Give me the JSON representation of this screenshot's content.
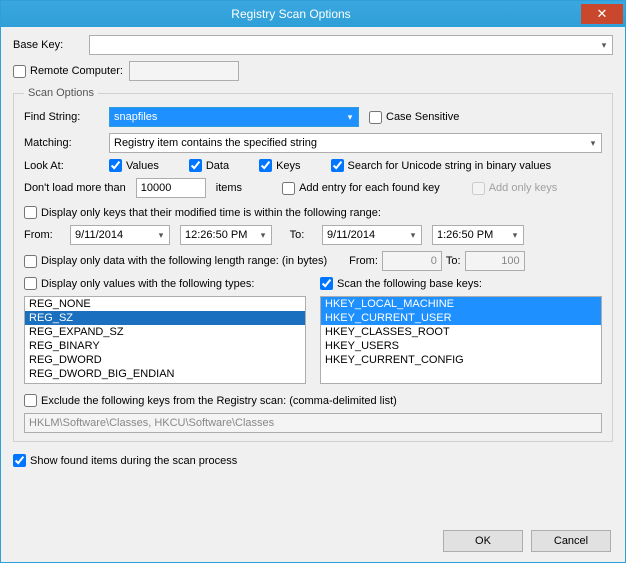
{
  "window": {
    "title": "Registry Scan Options"
  },
  "baseKey": {
    "label": "Base Key:",
    "value": ""
  },
  "remoteComputer": {
    "label": "Remote Computer:",
    "checked": false,
    "value": ""
  },
  "scanOptions": {
    "legend": "Scan Options",
    "findLabel": "Find String:",
    "findValue": "snapfiles",
    "caseSensitive": {
      "label": "Case Sensitive",
      "checked": false
    },
    "matchingLabel": "Matching:",
    "matchingValue": "Registry item contains the specified string",
    "lookAtLabel": "Look At:",
    "values": {
      "label": "Values",
      "checked": true
    },
    "data": {
      "label": "Data",
      "checked": true
    },
    "keys": {
      "label": "Keys",
      "checked": true
    },
    "unicode": {
      "label": "Search for Unicode string in binary values",
      "checked": true
    },
    "dontLoadLabel1": "Don't load more than",
    "dontLoadValue": "10000",
    "dontLoadLabel2": "items",
    "addEntry": {
      "label": "Add entry for each found key",
      "checked": false
    },
    "addOnlyKeys": {
      "label": "Add only keys",
      "checked": false
    },
    "modTime": {
      "label": "Display only keys that their modified time is within the following range:",
      "checked": false
    },
    "fromLabel": "From:",
    "fromDate": "9/11/2014",
    "fromTime": "12:26:50 PM",
    "toLabel": "To:",
    "toDate": "9/11/2014",
    "toTime": "1:26:50 PM",
    "lenRange": {
      "label": "Display only data with the following length range: (in bytes)",
      "checked": false
    },
    "lenFromLabel": "From:",
    "lenFrom": "0",
    "lenToLabel": "To:",
    "lenTo": "100",
    "dispValTypes": {
      "label": "Display only values with the following types:",
      "checked": false
    },
    "scanBaseKeys": {
      "label": "Scan the following base keys:",
      "checked": true
    },
    "valTypes": [
      "REG_NONE",
      "REG_SZ",
      "REG_EXPAND_SZ",
      "REG_BINARY",
      "REG_DWORD",
      "REG_DWORD_BIG_ENDIAN"
    ],
    "baseKeys": [
      "HKEY_LOCAL_MACHINE",
      "HKEY_CURRENT_USER",
      "HKEY_CLASSES_ROOT",
      "HKEY_USERS",
      "HKEY_CURRENT_CONFIG"
    ],
    "exclude": {
      "label": "Exclude the following keys from the Registry scan: (comma-delimited list)",
      "checked": false
    },
    "excludeValue": "HKLM\\Software\\Classes, HKCU\\Software\\Classes"
  },
  "showFound": {
    "label": "Show found items during the scan process",
    "checked": true
  },
  "buttons": {
    "ok": "OK",
    "cancel": "Cancel"
  }
}
